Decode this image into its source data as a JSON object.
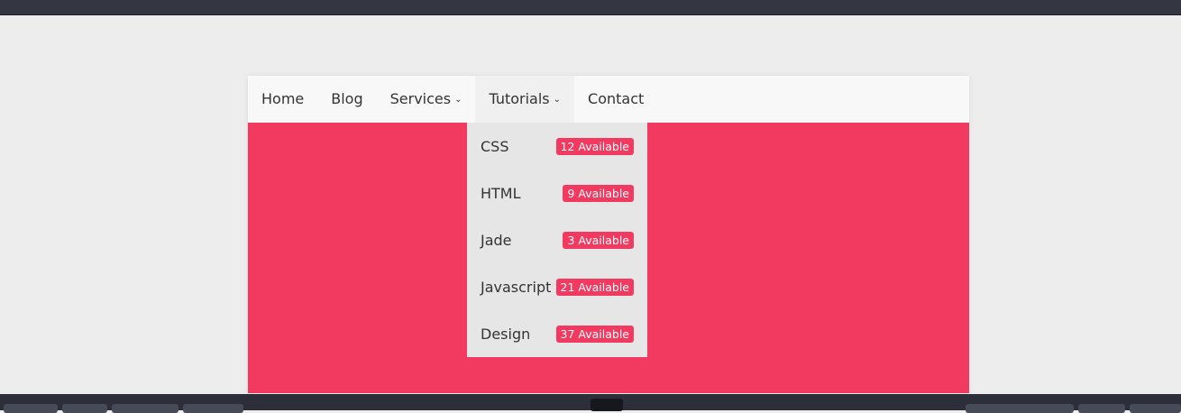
{
  "nav": {
    "items": [
      {
        "label": "Home"
      },
      {
        "label": "Blog"
      },
      {
        "label": "Services",
        "dropdown": true
      },
      {
        "label": "Tutorials",
        "dropdown": true,
        "active": true
      },
      {
        "label": "Contact"
      }
    ]
  },
  "dropdown": {
    "items": [
      {
        "label": "CSS",
        "badge": "12 Available"
      },
      {
        "label": "HTML",
        "badge": "9 Available"
      },
      {
        "label": "Jade",
        "badge": "3 Available"
      },
      {
        "label": "Javascript",
        "badge": "21 Available"
      },
      {
        "label": "Design",
        "badge": "37 Available"
      }
    ]
  },
  "colors": {
    "accent": "#f23a61",
    "nav_bg": "#f8f8f8",
    "dropdown_bg": "#e6e6e6"
  }
}
